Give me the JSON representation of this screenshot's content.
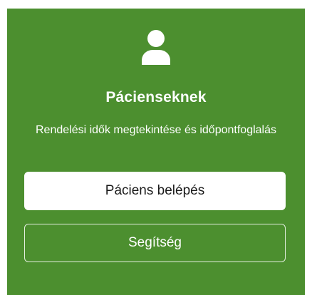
{
  "card": {
    "background_color": "#4c8f2f",
    "icon": "user-icon",
    "title": "Pácienseknek",
    "subtitle": "Rendelési idők megtekintése és időpontfoglalás",
    "primary_button_label": "Páciens belépés",
    "secondary_button_label": "Segítség"
  }
}
